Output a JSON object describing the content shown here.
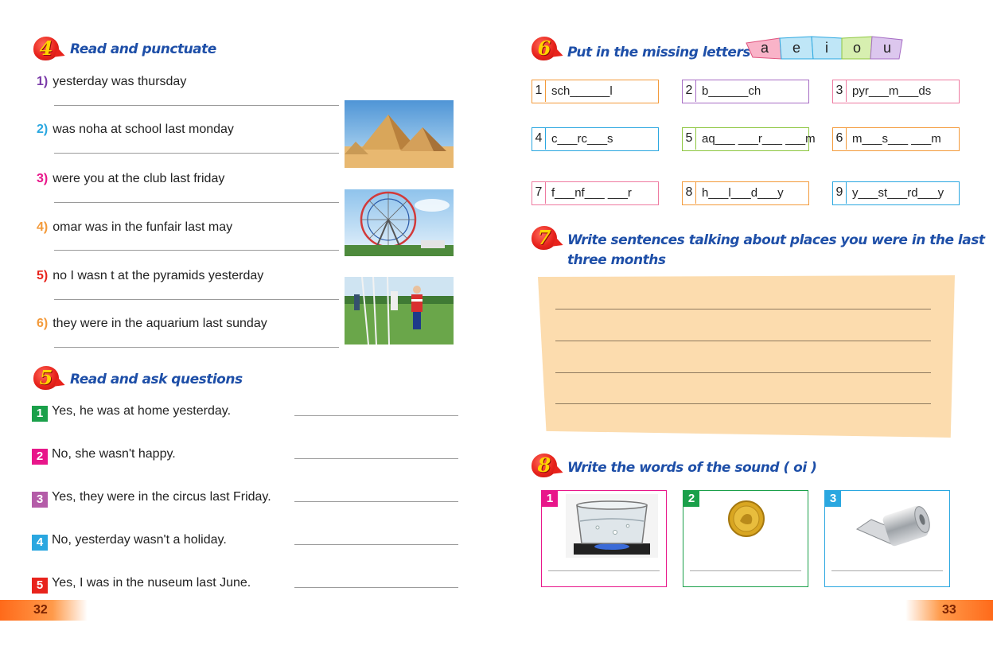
{
  "colors": {
    "heading": "#1e4fa8",
    "section_red": "#e8231c",
    "paper": "#fcdcae",
    "footer": "#ff8a3d"
  },
  "section4": {
    "number": "4",
    "title": "Read and punctuate",
    "items": [
      {
        "num": "1)",
        "text": "yesterday was thursday"
      },
      {
        "num": "2)",
        "text": "was noha at school last monday"
      },
      {
        "num": "3)",
        "text": "were you at the club last friday"
      },
      {
        "num": "4)",
        "text": "omar was in the funfair last may"
      },
      {
        "num": "5)",
        "text": "no I wasn t at the pyramids yesterday"
      },
      {
        "num": "6)",
        "text": "they were in the aquarium last sunday"
      }
    ],
    "images": [
      "pyramids-photo",
      "ferris-wheel-photo",
      "football-photo"
    ]
  },
  "section5": {
    "number": "5",
    "title": "Read and ask questions",
    "items": [
      {
        "num": "1",
        "text": "Yes, he was at home yesterday.",
        "color": "#1aa04a"
      },
      {
        "num": "2",
        "text": "No, she wasn't happy.",
        "color": "#e8168a"
      },
      {
        "num": "3",
        "text": "Yes, they were in the circus last Friday.",
        "color": "#b45ca8"
      },
      {
        "num": "4",
        "text": "No, yesterday wasn't a holiday.",
        "color": "#2aa7e0"
      },
      {
        "num": "5",
        "text": "Yes, I was in the nuseum last June.",
        "color": "#e8231c"
      }
    ]
  },
  "section6": {
    "number": "6",
    "title": "Put in the missing letters",
    "vowels": [
      "a",
      "e",
      "i",
      "o",
      "u"
    ],
    "boxes": [
      {
        "num": "1",
        "word": "sch______l",
        "color": "#f39a3a"
      },
      {
        "num": "2",
        "word": "b______ch",
        "color": "#a66cc4"
      },
      {
        "num": "3",
        "word": "pyr___m___ds",
        "color": "#ee7aa0"
      },
      {
        "num": "4",
        "word": "c___rc___s",
        "color": "#2aa7e0"
      },
      {
        "num": "5",
        "word": "aq___ ___r___ ___m",
        "color": "#8cc63e"
      },
      {
        "num": "6",
        "word": "m___s___ ___m",
        "color": "#f39a3a"
      },
      {
        "num": "7",
        "word": "f___nf___ ___r",
        "color": "#ee7aa0"
      },
      {
        "num": "8",
        "word": "h___l___d___y",
        "color": "#f39a3a"
      },
      {
        "num": "9",
        "word": "y___st___rd___y",
        "color": "#2aa7e0"
      }
    ]
  },
  "section7": {
    "number": "7",
    "title_line1": "Write sentences talking about places you were in the last",
    "title_line2": "three months"
  },
  "section8": {
    "number": "8",
    "title": "Write the words of the sound ( oi )",
    "cards": [
      {
        "num": "1",
        "color": "#e8168a",
        "image": "boiling-water-image"
      },
      {
        "num": "2",
        "color": "#1aa04a",
        "image": "coin-image"
      },
      {
        "num": "3",
        "color": "#2aa7e0",
        "image": "foil-roll-image"
      }
    ]
  },
  "footer": {
    "left_page": "32",
    "right_page": "33"
  }
}
